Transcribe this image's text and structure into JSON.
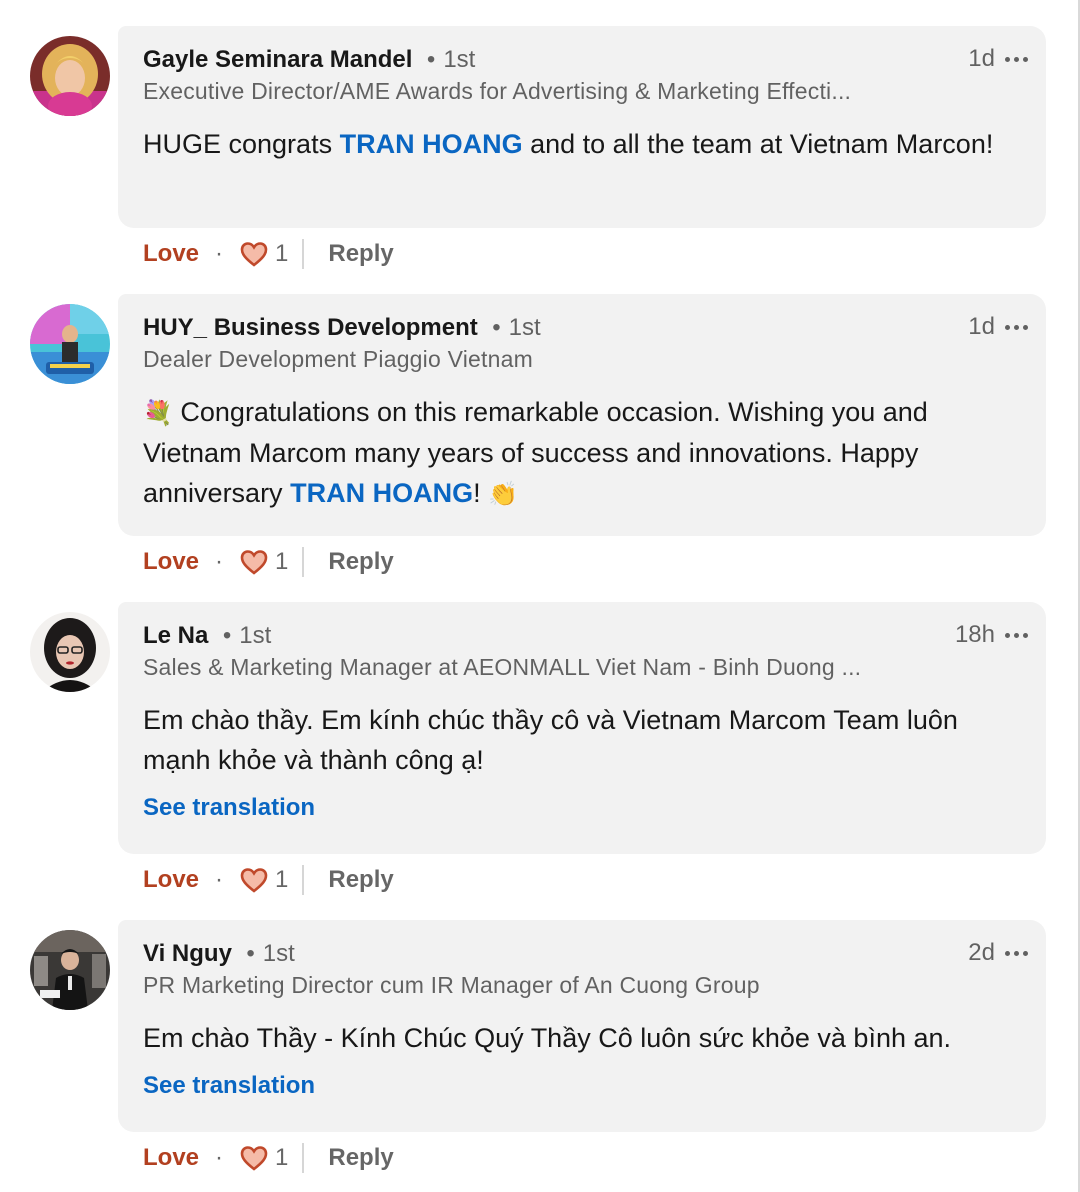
{
  "comments": [
    {
      "name": "Gayle Seminara Mandel",
      "degree": "1st",
      "headline": "Executive Director/AME Awards for Advertising & Marketing Effecti...",
      "time": "1d",
      "text_parts": [
        "HUGE congrats ",
        "TRAN HOANG",
        " and to all the team at Vietnam Marcon!"
      ],
      "love_label": "Love",
      "reaction_count": "1",
      "reply_label": "Reply"
    },
    {
      "name": "HUY_ Business Development",
      "degree": "1st",
      "headline": "Dealer Development Piaggio Vietnam",
      "time": "1d",
      "text_parts": [
        "💐",
        " Congratulations on this remarkable occasion. Wishing you and Vietnam Marcom many years of success and innovations. Happy anniversary ",
        "TRAN HOANG",
        "! ",
        "👏"
      ],
      "love_label": "Love",
      "reaction_count": "1",
      "reply_label": "Reply"
    },
    {
      "name": "Le Na",
      "degree": "1st",
      "headline": "Sales & Marketing Manager at AEONMALL Viet Nam - Binh Duong ...",
      "time": "18h",
      "text": "Em chào thầy. Em kính chúc thầy cô và Vietnam Marcom Team luôn mạnh khỏe và thành công ạ!",
      "see_translation": "See translation",
      "love_label": "Love",
      "reaction_count": "1",
      "reply_label": "Reply"
    },
    {
      "name": "Vi Nguy",
      "degree": "1st",
      "headline": "PR Marketing Director cum IR Manager of An Cuong Group",
      "time": "2d",
      "text": "Em chào Thầy - Kính Chúc Quý Thầy Cô luôn sức khỏe và bình an.",
      "see_translation": "See translation",
      "love_label": "Love",
      "reaction_count": "1",
      "reply_label": "Reply"
    }
  ],
  "colors": {
    "mention": "#0a66c2",
    "love": "#b24020",
    "heart_fill": "#f5bba8",
    "heart_stroke": "#c0492b",
    "bubble": "#f2f2f2"
  },
  "icons": [
    "more-icon",
    "love-reaction-icon",
    "bouquet-emoji",
    "clap-emoji"
  ]
}
